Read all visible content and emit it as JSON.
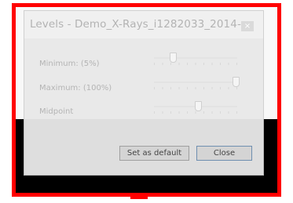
{
  "dialog": {
    "title": "Levels - Demo_X-Rays_i1282033_2014- ...",
    "close_glyph": "×",
    "rows": [
      {
        "label": "Minimum: (5%)",
        "value_percent": 5
      },
      {
        "label": "Maximum: (100%)",
        "value_percent": 100
      },
      {
        "label": "Midpoint",
        "value_percent": 50
      }
    ],
    "buttons": {
      "set_default": "Set as default",
      "close": "Close"
    }
  },
  "colors": {
    "highlight": "#ff0000",
    "background": "#000000"
  }
}
